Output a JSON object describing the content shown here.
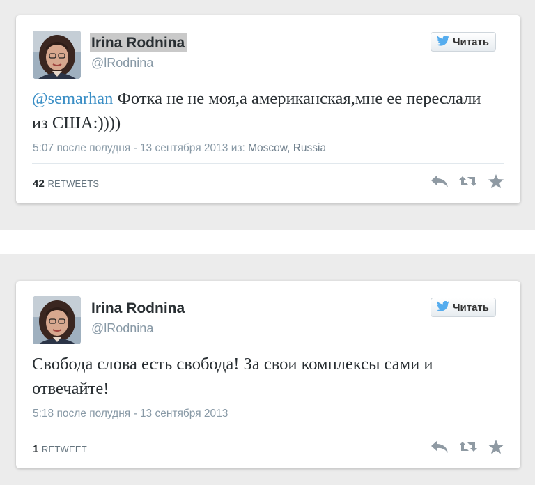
{
  "tweets": [
    {
      "name": "Irina Rodnina",
      "handle": "@lRodnina",
      "follow_label": "Читать",
      "mention": "@semarhan",
      "text": " Фотка не не моя,а американская,мне ее переслали из США:))))",
      "timestamp": "5:07 после полудня - 13 сентября 2013 из: ",
      "place": "Moscow, Russia",
      "retweet_count": "42",
      "retweet_label": "RETWEETS"
    },
    {
      "name": "Irina Rodnina",
      "handle": "@lRodnina",
      "follow_label": "Читать",
      "text": "Свобода слова есть свобода! За свои комплексы сами и отвечайте!",
      "timestamp": "5:18 после полудня - 13 сентября 2013",
      "retweet_count": "1",
      "retweet_label": "RETWEET"
    }
  ],
  "colors": {
    "background_band": "#ececec",
    "card": "#ffffff",
    "name": "#292f33",
    "muted": "#8899a6",
    "mention": "#3a8ec5",
    "twitter_blue": "#55acee",
    "action_icon": "#8f9aa3"
  },
  "icons": [
    "twitter-bird-icon",
    "reply-icon",
    "retweet-icon",
    "favorite-star-icon"
  ]
}
